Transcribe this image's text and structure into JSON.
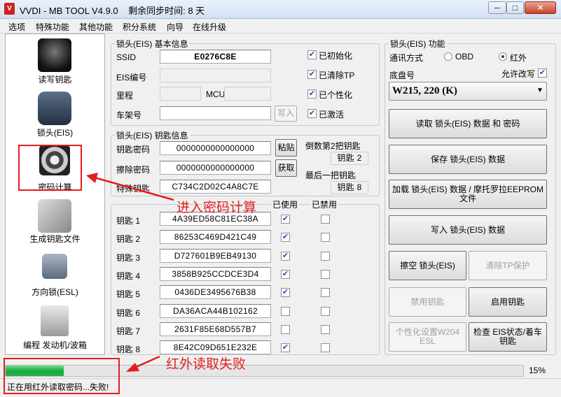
{
  "window": {
    "title": "VVDI - MB TOOL V4.9.0    剩余同步时间: 8 天",
    "icon_text": "V",
    "min": "─",
    "max": "□",
    "close": "✕"
  },
  "menu": [
    "选项",
    "特殊功能",
    "其他功能",
    "积分系统",
    "向导",
    "在线升级"
  ],
  "nav": [
    {
      "label": "读写钥匙",
      "icon": "key-fob-icon"
    },
    {
      "label": "锁头(EIS)",
      "icon": "eis-lock-icon"
    },
    {
      "label": "密码计算",
      "icon": "gear-lock-icon"
    },
    {
      "label": "生成钥匙文件",
      "icon": "key-file-icon"
    },
    {
      "label": "方向锁(ESL)",
      "icon": "steering-lock-icon"
    },
    {
      "label": "编程 发动机/波箱",
      "icon": "ecu-icon"
    }
  ],
  "eis_basic": {
    "title": "锁头(EIS) 基本信息",
    "ssid_label": "SSID",
    "ssid": "E0276C8E",
    "eis_no_label": "EIS编号",
    "eis_no": "",
    "mileage_label": "里程",
    "mileage": "",
    "mcu_label": "MCU",
    "mcu": "",
    "vin_label": "车架号",
    "vin": "",
    "write_button": "写入",
    "checks": [
      {
        "label": "已初始化",
        "checked": true
      },
      {
        "label": "已清除TP",
        "checked": true
      },
      {
        "label": "已个性化",
        "checked": true
      },
      {
        "label": "已激活",
        "checked": true
      }
    ]
  },
  "key_info": {
    "title": "锁头(EIS) 钥匙信息",
    "key_pw_label": "钥匙密码",
    "key_pw": "0000000000000000",
    "erase_pw_label": "擦除密码",
    "erase_pw": "0000000000000000",
    "special_label": "特殊钥匙",
    "special": "C734C2D02C4A8C7E",
    "paste_button": "粘贴",
    "get_button": "获取",
    "second_last_label": "倒数第2把钥匙",
    "second_last": "钥匙 2",
    "last_label": "最后一把钥匙",
    "last": "钥匙 8"
  },
  "keys": {
    "used_header": "已使用",
    "disabled_header": "已禁用",
    "rows": [
      {
        "label": "钥匙 1",
        "value": "4A39ED58C81EC38A",
        "used": true,
        "disabled": false
      },
      {
        "label": "钥匙 2",
        "value": "86253C469D421C49",
        "used": true,
        "disabled": false
      },
      {
        "label": "钥匙 3",
        "value": "D727601B9EB49130",
        "used": true,
        "disabled": false
      },
      {
        "label": "钥匙 4",
        "value": "3858B925CCDCE3D4",
        "used": true,
        "disabled": false
      },
      {
        "label": "钥匙 5",
        "value": "0436DE3495676B38",
        "used": true,
        "disabled": false
      },
      {
        "label": "钥匙 6",
        "value": "DA36ACA44B102162",
        "used": false,
        "disabled": false
      },
      {
        "label": "钥匙 7",
        "value": "2631F85E68D557B7",
        "used": false,
        "disabled": false
      },
      {
        "label": "钥匙 8",
        "value": "8E42C09D651E232E",
        "used": true,
        "disabled": false
      }
    ]
  },
  "eis_func": {
    "title": "锁头(EIS) 功能",
    "comm_label": "通讯方式",
    "obd_label": "OBD",
    "ir_label": "红外",
    "ir_selected": true,
    "chassis_label": "底盘号",
    "allow_edit_label": "允许改写",
    "allow_edit": true,
    "chassis": "W215, 220 (K)",
    "read_button": "读取 锁头(EIS) 数据 和 密码",
    "save_button": "保存 锁头(EIS) 数据",
    "load_button": "加载 锁头(EIS) 数据 / 摩托罗拉EEPROM 文件",
    "write_button": "写入 锁头(EIS) 数据",
    "erase_button": "擦空 锁头(EIS)",
    "clear_tp_button": "清除TP保护",
    "disable_key_button": "禁用钥匙",
    "enable_key_button": "启用钥匙",
    "personalize_button": "个性化设置W204 ESL",
    "check_button": "检查 EIS状态/着车钥匙"
  },
  "progress": {
    "percent": 15,
    "label": "15%"
  },
  "status": "正在用红外读取密码...失败!",
  "annotations": {
    "enter_calc": "进入密码计算",
    "ir_fail": "红外读取失败"
  },
  "colors": {
    "annotation_red": "#e31e1e",
    "progress_green": "#22b14c"
  }
}
